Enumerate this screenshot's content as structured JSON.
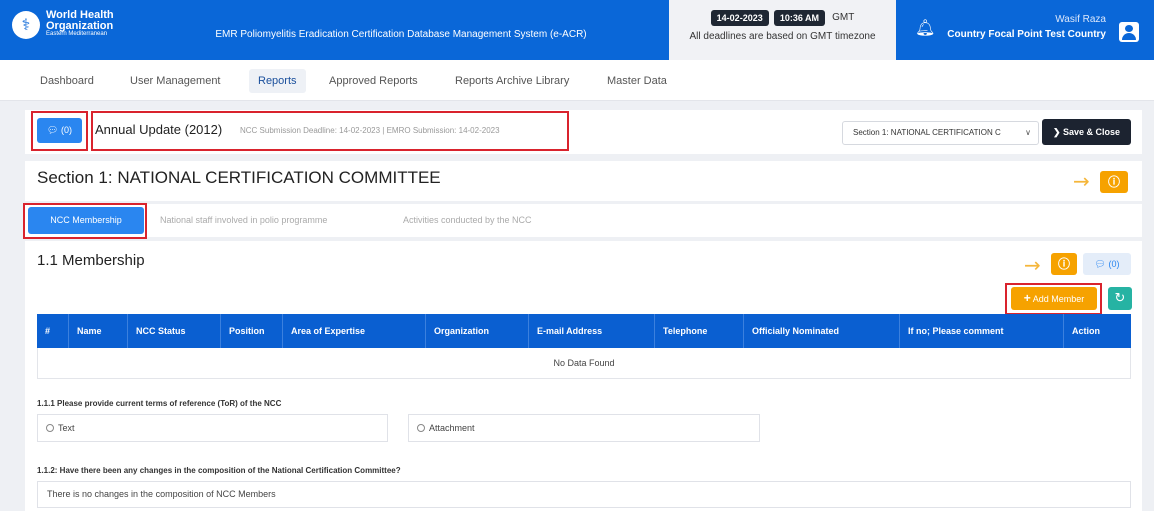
{
  "header": {
    "org_line1": "World Health",
    "org_line2": "Organization",
    "org_region": "Eastern Mediterranean",
    "app_title": "EMR Poliomyelitis Eradication Certification Database Management System (e-ACR)",
    "date": "14-02-2023",
    "time": "10:36 AM",
    "timezone": "GMT",
    "deadline_note": "All deadlines are based on GMT timezone",
    "user_name": "Wasif Raza",
    "user_role": "Country Focal Point Test Country"
  },
  "nav": {
    "items": [
      "Dashboard",
      "User Management",
      "Reports",
      "Approved Reports",
      "Reports Archive Library",
      "Master Data"
    ],
    "active": "Reports"
  },
  "report": {
    "comments_count": "(0)",
    "title": "Annual Update (2012)",
    "submission_info": "NCC Submission Deadline: 14-02-2023 | EMRO Submission: 14-02-2023",
    "section_select": "Section 1: NATIONAL CERTIFICATION C",
    "save_close": "Save & Close"
  },
  "section": {
    "title": "Section 1: NATIONAL CERTIFICATION COMMITTEE",
    "tabs": [
      "NCC Membership",
      "National staff involved in polio programme",
      "Activities conducted by the NCC"
    ],
    "active_tab": "NCC Membership"
  },
  "membership": {
    "title": "1.1 Membership",
    "comments_count": "(0)",
    "add_label": "Add Member",
    "columns": [
      "#",
      "Name",
      "NCC Status",
      "Position",
      "Area of Expertise",
      "Organization",
      "E-mail Address",
      "Telephone",
      "Officially Nominated",
      "If no; Please comment",
      "Action"
    ],
    "empty_text": "No Data Found"
  },
  "questions": {
    "q1": "1.1.1 Please provide current terms of reference (ToR) of the NCC",
    "q1_options": [
      "Text",
      "Attachment"
    ],
    "q2": "1.1.2: Have there been any changes in the composition of the National Certification Committee?",
    "q2_answer": "There is no changes in the composition of NCC Members"
  },
  "colors": {
    "brand_blue": "#0a67d8",
    "table_blue": "#0a5fd1",
    "accent_orange": "#f6a200",
    "teal": "#26b3a3",
    "annotation_red": "#d9232d"
  }
}
